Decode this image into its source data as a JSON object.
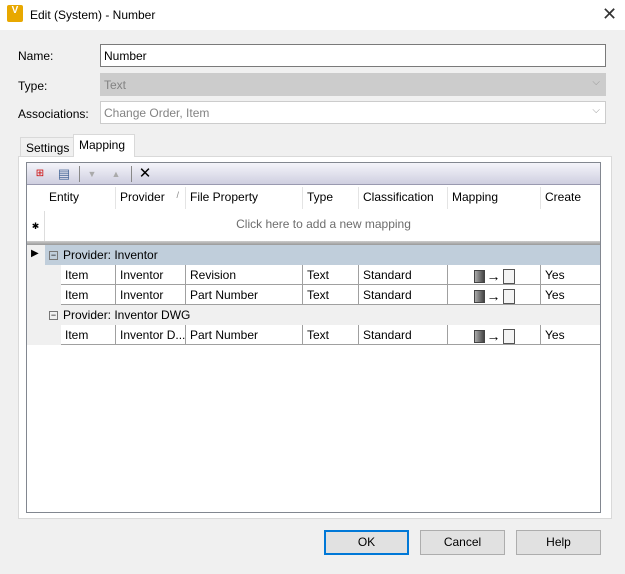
{
  "window": {
    "title": "Edit (System) - Number",
    "icon": "V"
  },
  "form": {
    "name_label": "Name:",
    "name_value": "Number",
    "type_label": "Type:",
    "type_value": "Text",
    "assoc_label": "Associations:",
    "assoc_value": "Change Order, Item"
  },
  "tabs": [
    "Settings",
    "Mapping"
  ],
  "grid": {
    "columns": [
      "Entity",
      "Provider",
      "File Property",
      "Type",
      "Classification",
      "Mapping",
      "Create"
    ],
    "new_row_text": "Click here to add a new mapping",
    "groups": [
      {
        "label": "Provider: Inventor",
        "rows": [
          {
            "entity": "Item",
            "provider": "Inventor",
            "property": "Revision",
            "type": "Text",
            "classification": "Standard",
            "create": "Yes"
          },
          {
            "entity": "Item",
            "provider": "Inventor",
            "property": "Part Number",
            "type": "Text",
            "classification": "Standard",
            "create": "Yes"
          }
        ]
      },
      {
        "label": "Provider: Inventor DWG",
        "rows": [
          {
            "entity": "Item",
            "provider": "Inventor D...",
            "property": "Part Number",
            "type": "Text",
            "classification": "Standard",
            "create": "Yes"
          }
        ]
      }
    ]
  },
  "buttons": {
    "ok": "OK",
    "cancel": "Cancel",
    "help": "Help"
  }
}
